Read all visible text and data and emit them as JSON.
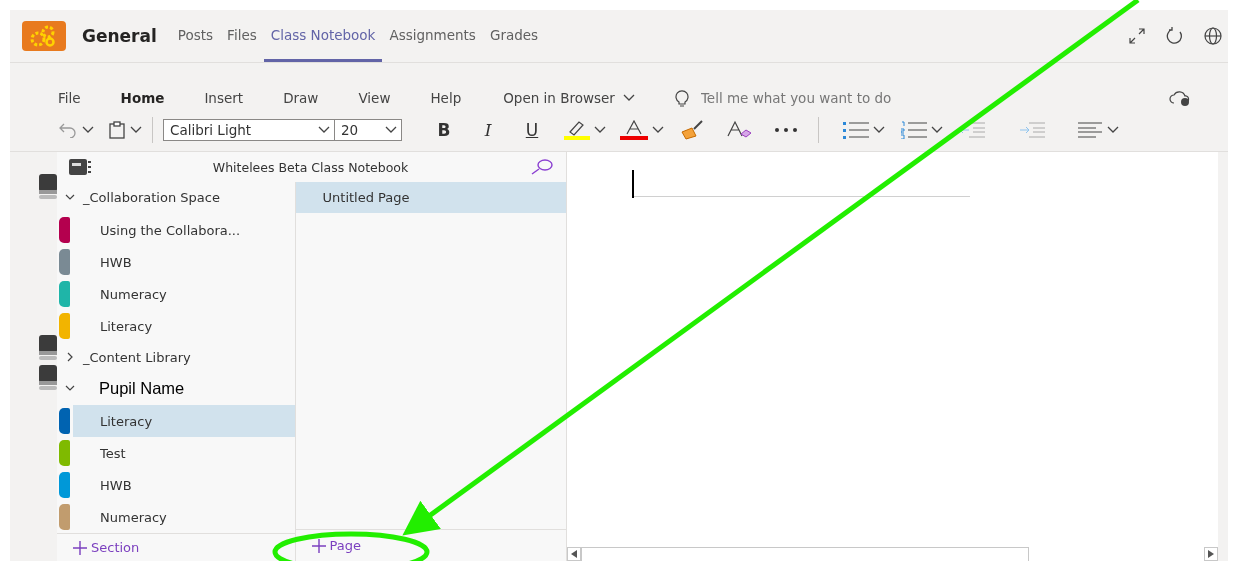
{
  "header": {
    "team_name": "General",
    "tabs": [
      {
        "label": "Posts",
        "selected": false
      },
      {
        "label": "Files",
        "selected": false
      },
      {
        "label": "Class Notebook",
        "selected": true
      },
      {
        "label": "Assignments",
        "selected": false
      },
      {
        "label": "Grades",
        "selected": false
      }
    ]
  },
  "ribbon": {
    "menu": [
      {
        "label": "File",
        "selected": false
      },
      {
        "label": "Home",
        "selected": true
      },
      {
        "label": "Insert",
        "selected": false
      },
      {
        "label": "Draw",
        "selected": false
      },
      {
        "label": "View",
        "selected": false
      },
      {
        "label": "Help",
        "selected": false
      }
    ],
    "open_in_browser": "Open in Browser",
    "tell_me": {
      "placeholder": "Tell me what you want to do"
    },
    "font": {
      "value": "Calibri Light"
    },
    "size": {
      "value": "20"
    },
    "format_buttons": [
      {
        "kind": "bold",
        "label": "B"
      },
      {
        "kind": "italic",
        "label": "I"
      },
      {
        "kind": "underline",
        "label": "U"
      }
    ]
  },
  "notebook": {
    "title": "Whitelees Beta Class Notebook",
    "groups": [
      {
        "kind": "group",
        "label": "_Collaboration Space",
        "expanded": true,
        "children": [
          {
            "label": "Using the Collabora...",
            "color": "#b4004e",
            "selected": false
          },
          {
            "label": "HWB",
            "color": "#7a8a94",
            "selected": false
          },
          {
            "label": "Numeracy",
            "color": "#1fb5a8",
            "selected": false
          },
          {
            "label": "Literacy",
            "color": "#f2b400",
            "selected": false
          }
        ]
      },
      {
        "kind": "group",
        "label": "_Content Library",
        "expanded": false
      },
      {
        "kind": "typed",
        "label": "Pupil Name",
        "expanded": true,
        "children": [
          {
            "label": "Literacy",
            "color": "#0063b1",
            "selected": true
          },
          {
            "label": "Test",
            "color": "#7fba00",
            "selected": false
          },
          {
            "label": "HWB",
            "color": "#0098d8",
            "selected": false
          },
          {
            "label": "Numeracy",
            "color": "#c19c6e",
            "selected": false
          }
        ]
      }
    ],
    "add_section": "Section"
  },
  "pages": {
    "items": [
      {
        "label": "Untitled Page",
        "selected": true
      }
    ],
    "add_page": "Page"
  }
}
